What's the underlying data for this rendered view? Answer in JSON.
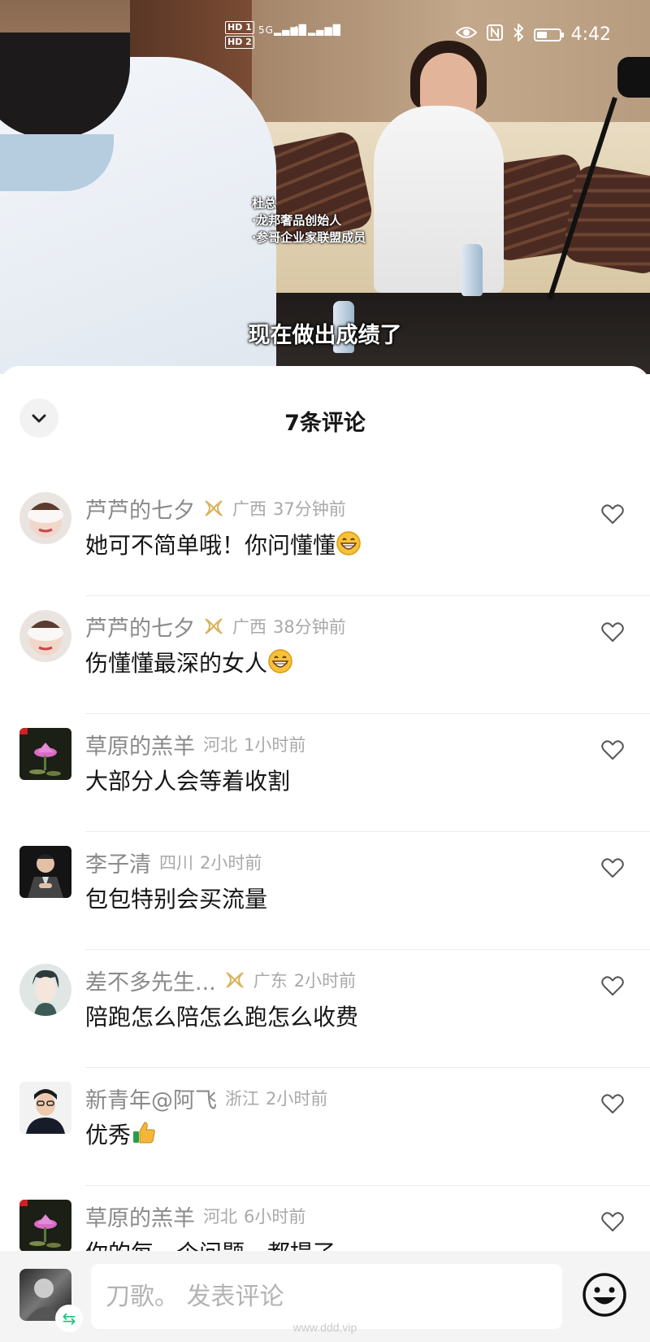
{
  "status_bar": {
    "hd1": "HD 1",
    "hd2": "HD 2",
    "signal1": "5G",
    "signal2": "4G",
    "time": "4:42",
    "battery_level": 0.45,
    "icons": [
      "eye-icon",
      "nfc-icon",
      "bluetooth-icon",
      "battery-icon"
    ]
  },
  "video": {
    "caption_lines": [
      "杜总",
      "·龙邦奢品创始人",
      "·参哥企业家联盟成员"
    ],
    "subtitle": "现在做出成绩了"
  },
  "sheet": {
    "title": "7条评论",
    "collapse_icon": "chevron-down-icon"
  },
  "comments": [
    {
      "username": "芦芦的七夕",
      "badge": true,
      "location": "广西",
      "time": "37分钟前",
      "text": "她可不简单哦！你问懂懂",
      "emoji": "grin",
      "avatar": "woman-blur"
    },
    {
      "username": "芦芦的七夕",
      "badge": true,
      "location": "广西",
      "time": "38分钟前",
      "text": "伤懂懂最深的女人",
      "emoji": "grin",
      "avatar": "woman-blur"
    },
    {
      "username": "草原的羔羊",
      "badge": false,
      "location": "河北",
      "time": "1小时前",
      "text": "大部分人会等着收割",
      "emoji": "",
      "avatar": "lotus"
    },
    {
      "username": "李子清",
      "badge": false,
      "location": "四川",
      "time": "2小时前",
      "text": "包包特别会买流量",
      "emoji": "",
      "avatar": "man-suit"
    },
    {
      "username": "差不多先生...",
      "badge": true,
      "location": "广东",
      "time": "2小时前",
      "text": "陪跑怎么陪怎么跑怎么收费",
      "emoji": "",
      "avatar": "drawn-man"
    },
    {
      "username": "新青年@阿飞",
      "badge": false,
      "location": "浙江",
      "time": "2小时前",
      "text": "优秀",
      "emoji": "thumbs-up",
      "avatar": "young-man"
    },
    {
      "username": "草原的羔羊",
      "badge": false,
      "location": "河北",
      "time": "6小时前",
      "text": "你的每一个问题，都提了",
      "emoji": "",
      "avatar": "lotus"
    }
  ],
  "input_bar": {
    "placeholder": "刀歌。 发表评论",
    "emoji_icon": "smiley-icon"
  },
  "watermark": "www.ddd.vip",
  "colors": {
    "username": "#8a8a8a",
    "meta": "#a9a9a9",
    "badge": "#d8b25a",
    "text": "#161616"
  }
}
